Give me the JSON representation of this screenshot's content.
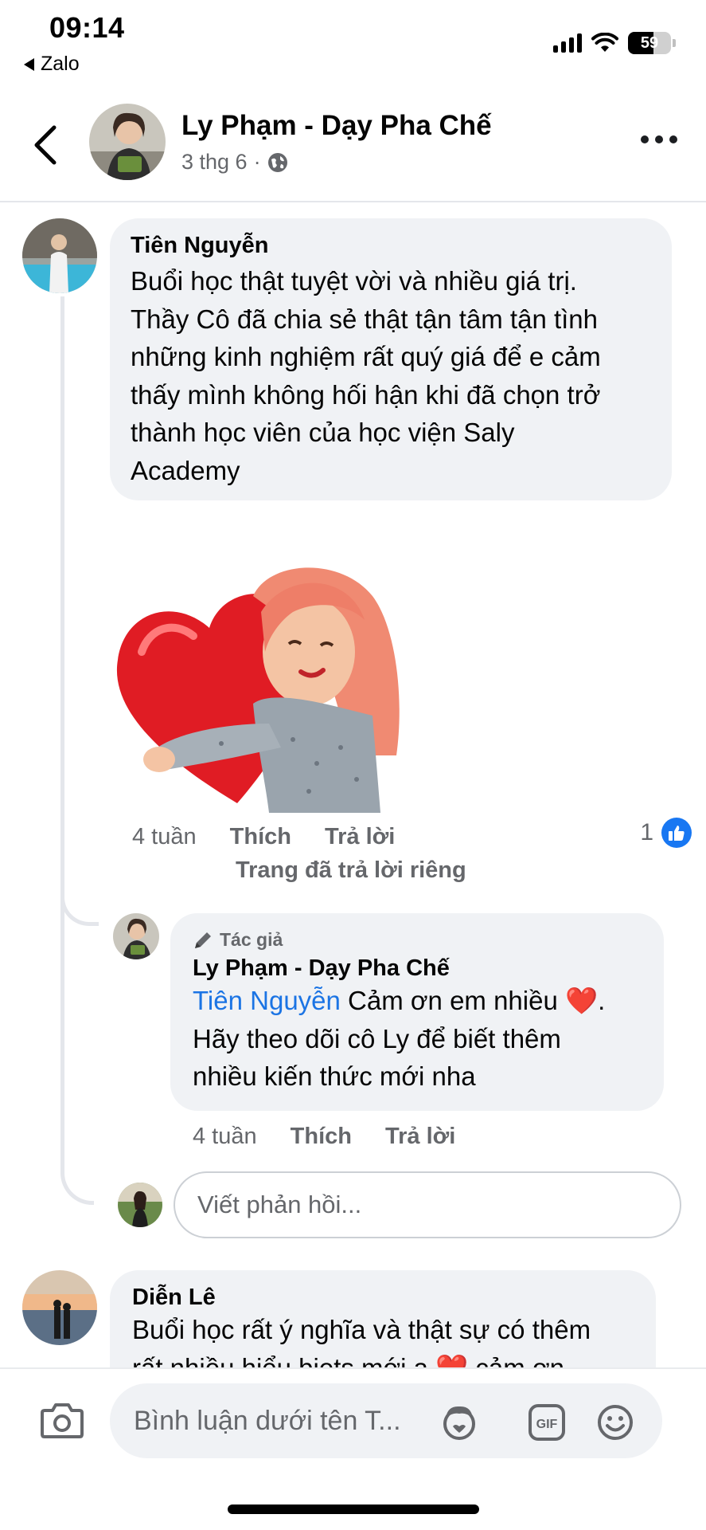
{
  "status_bar": {
    "time": "09:14",
    "back_app": "Zalo",
    "battery": "59",
    "battery_level": 0.59
  },
  "header": {
    "title": "Ly Phạm - Dạy Pha Chế",
    "date": "3 thg 6",
    "separator": "·"
  },
  "comments": [
    {
      "author": "Tiên Nguyễn",
      "lines": [
        "Buổi học thật tuyệt vời và nhiều giá trị.",
        "Thầy Cô đã chia sẻ thật tận tâm tận tình",
        "những kinh nghiệm rất quý giá để e cảm",
        "thấy mình không hối hận khi đã chọn trở",
        "thành học viên của học viện Saly",
        "Academy"
      ],
      "time": "4 tuần",
      "like_label": "Thích",
      "reply_label": "Trả lời",
      "private_reply_note": "Trang đã trả lời riêng",
      "like_count": "1"
    }
  ],
  "reply": {
    "author_tag": "Tác giả",
    "author": "Ly Phạm - Dạy Pha Chế",
    "mention": "Tiên Nguyễn",
    "line1_rest": " Cảm ơn em nhiều ",
    "heart": "❤️",
    "line1_end": ".",
    "line2": "Hãy theo dõi cô Ly để biết thêm",
    "line3": "nhiều kiến thức mới nha",
    "time": "4 tuần",
    "like_label": "Thích",
    "reply_label": "Trả lời"
  },
  "reply_input": {
    "placeholder": "Viết phản hồi..."
  },
  "comment2": {
    "author": "Diễn Lê",
    "line1": "Buổi học rất ý nghĩa và thật sự có thêm",
    "line2": "rất nhiều hiểu biets mới a ❤️ cảm ơn"
  },
  "composer": {
    "placeholder": "Bình luận dưới tên T..."
  }
}
